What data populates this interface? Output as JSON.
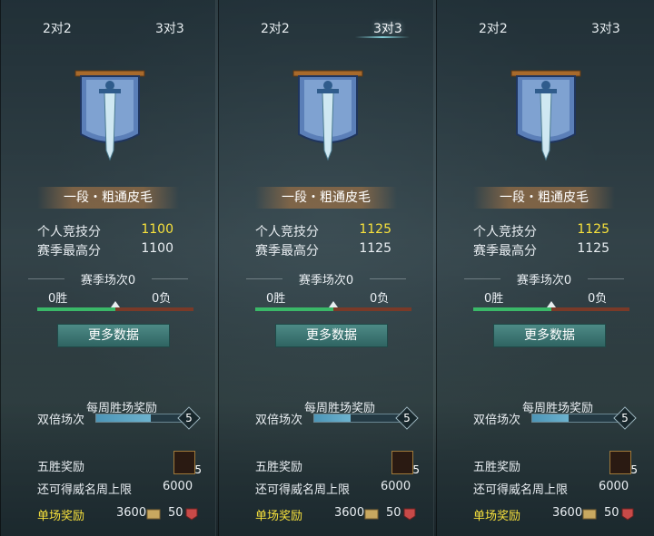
{
  "panels": [
    {
      "tabs": {
        "left": "2对2",
        "right": "3对3"
      },
      "rank": "一段・粗通皮毛",
      "personal_label": "个人竞技分",
      "personal_value": "1100",
      "season_high_label": "赛季最高分",
      "season_high_value": "1100",
      "season_count": "赛季场次0",
      "wins": "0胜",
      "losses": "0负",
      "more_data": "更多数据",
      "weekly_reward": "每周胜场奖励",
      "double_label": "双倍场次",
      "double_value": "5",
      "five_win_label": "五胜奖励",
      "chest_count": "5",
      "cap_label": "还可得威名周上限",
      "cap_value": "6000",
      "single_label": "单场奖励",
      "single_coin": "3600",
      "single_badge": "50"
    },
    {
      "tabs": {
        "left": "2对2",
        "right": "3对3"
      },
      "rank": "一段・粗通皮毛",
      "personal_label": "个人竞技分",
      "personal_value": "1125",
      "season_high_label": "赛季最高分",
      "season_high_value": "1125",
      "season_count": "赛季场次0",
      "wins": "0胜",
      "losses": "0负",
      "more_data": "更多数据",
      "weekly_reward": "每周胜场奖励",
      "double_label": "双倍场次",
      "double_value": "5",
      "five_win_label": "五胜奖励",
      "chest_count": "5",
      "cap_label": "还可得威名周上限",
      "cap_value": "6000",
      "single_label": "单场奖励",
      "single_coin": "3600",
      "single_badge": "50"
    },
    {
      "tabs": {
        "left": "2对2",
        "right": "3对3"
      },
      "rank": "一段・粗通皮毛",
      "personal_label": "个人竞技分",
      "personal_value": "1125",
      "season_high_label": "赛季最高分",
      "season_high_value": "1125",
      "season_count": "赛季场次0",
      "wins": "0胜",
      "losses": "0负",
      "more_data": "更多数据",
      "weekly_reward": "每周胜场奖励",
      "double_label": "双倍场次",
      "double_value": "5",
      "five_win_label": "五胜奖励",
      "chest_count": "5",
      "cap_label": "还可得威名周上限",
      "cap_value": "6000",
      "single_label": "单场奖励",
      "single_coin": "3600",
      "single_badge": "50"
    }
  ],
  "colors": {
    "highlight": "#f7e13c",
    "win": "#3ab868",
    "loss": "#7a3a28",
    "button": "#3f7a77"
  },
  "win_ratio": 0.5
}
